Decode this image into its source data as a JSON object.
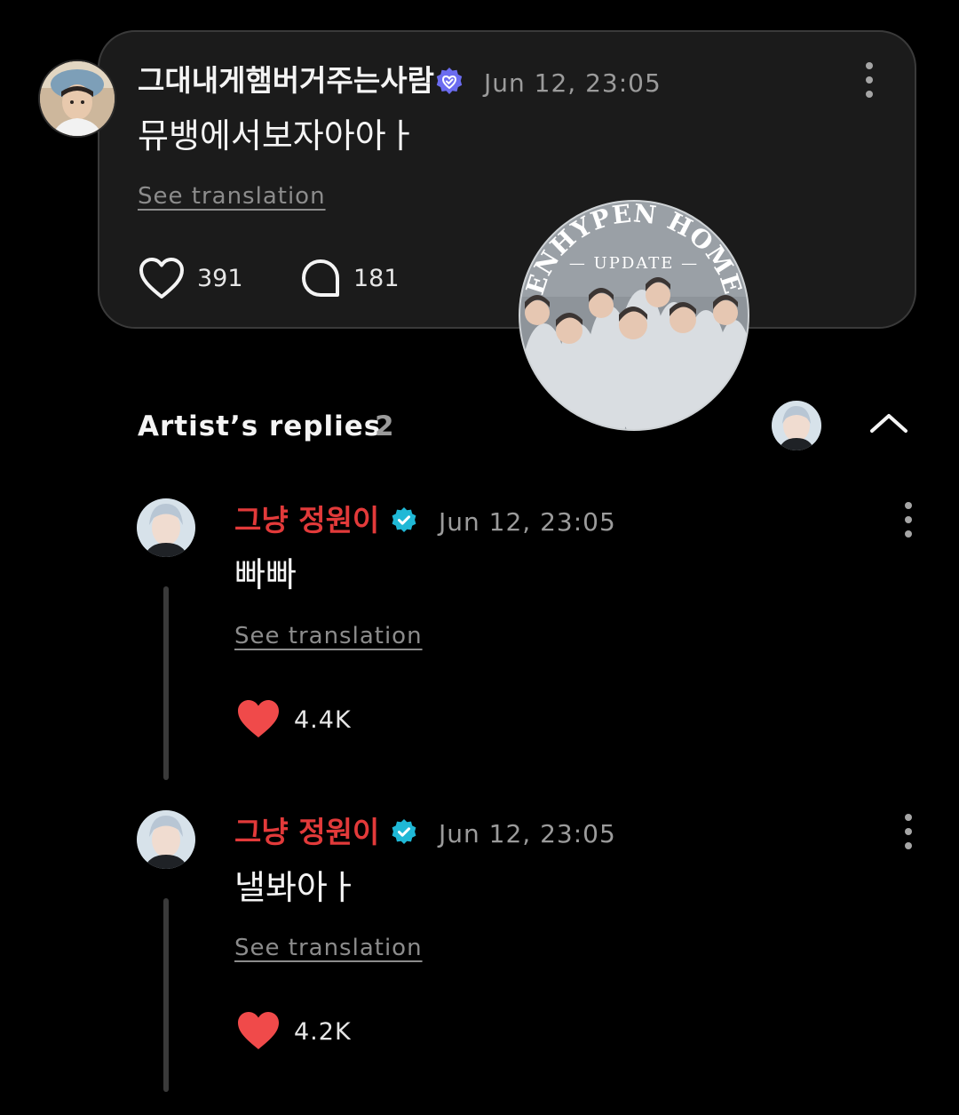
{
  "post": {
    "username": "그대내게햄버거주는사람",
    "timestamp": "Jun 12, 23:05",
    "body": "뮤뱅에서보자아아ㅏ",
    "see_translation": "See translation",
    "like_count": "391",
    "comment_count": "181",
    "icons": [
      "verified-badge-icon",
      "kebab-menu-icon",
      "heart-outline-icon",
      "comment-bubble-icon"
    ]
  },
  "watermark": {
    "top_text": "ENHYPEN HOME",
    "sub_text": "— UPDATE —"
  },
  "artist_replies": {
    "title": "Artist’s replies",
    "count": "2",
    "icons": [
      "chevron-up-icon"
    ]
  },
  "replies": [
    {
      "username": "그냥 정원이",
      "timestamp": "Jun 12, 23:05",
      "body": "빠빠",
      "see_translation": "See translation",
      "like_count": "4.4K"
    },
    {
      "username": "그냥 정원이",
      "timestamp": "Jun 12, 23:05",
      "body": "낼봐아ㅏ",
      "see_translation": "See translation",
      "like_count": "4.2K"
    }
  ],
  "colors": {
    "background": "#000000",
    "card": "#1b1b1b",
    "artist_name": "#e23a3a",
    "verified_artist": "#1fb8d6",
    "verified_user": "#6b6cf0",
    "like_filled": "#f04a4a"
  }
}
